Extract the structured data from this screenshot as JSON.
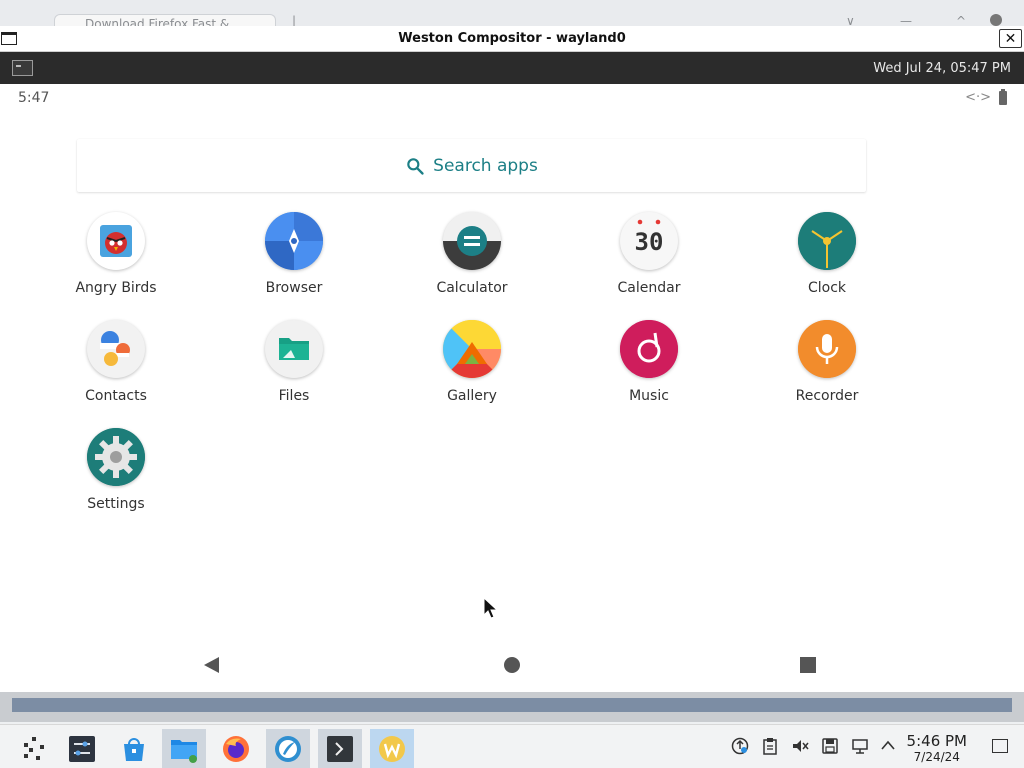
{
  "background_browser": {
    "tab_title": "Download Firefox Fast & ..."
  },
  "window": {
    "title": "Weston Compositor - wayland0",
    "close_label": "✕"
  },
  "weston_panel": {
    "clock": "Wed Jul 24, 05:47 PM"
  },
  "android": {
    "status_time": "5:47",
    "search_label": "Search apps",
    "apps": [
      {
        "label": "Angry Birds",
        "icon": "angry-birds-icon"
      },
      {
        "label": "Browser",
        "icon": "browser-icon"
      },
      {
        "label": "Calculator",
        "icon": "calculator-icon"
      },
      {
        "label": "Calendar",
        "icon": "calendar-icon",
        "day": "30"
      },
      {
        "label": "Clock",
        "icon": "clock-icon"
      },
      {
        "label": "Contacts",
        "icon": "contacts-icon"
      },
      {
        "label": "Files",
        "icon": "files-icon"
      },
      {
        "label": "Gallery",
        "icon": "gallery-icon"
      },
      {
        "label": "Music",
        "icon": "music-icon"
      },
      {
        "label": "Recorder",
        "icon": "recorder-icon"
      },
      {
        "label": "Settings",
        "icon": "settings-icon"
      }
    ]
  },
  "taskbar": {
    "time": "5:46 PM",
    "date": "7/24/24"
  },
  "colors": {
    "accent_teal": "#1c7f86",
    "panel_dark": "#2b2b2b"
  }
}
